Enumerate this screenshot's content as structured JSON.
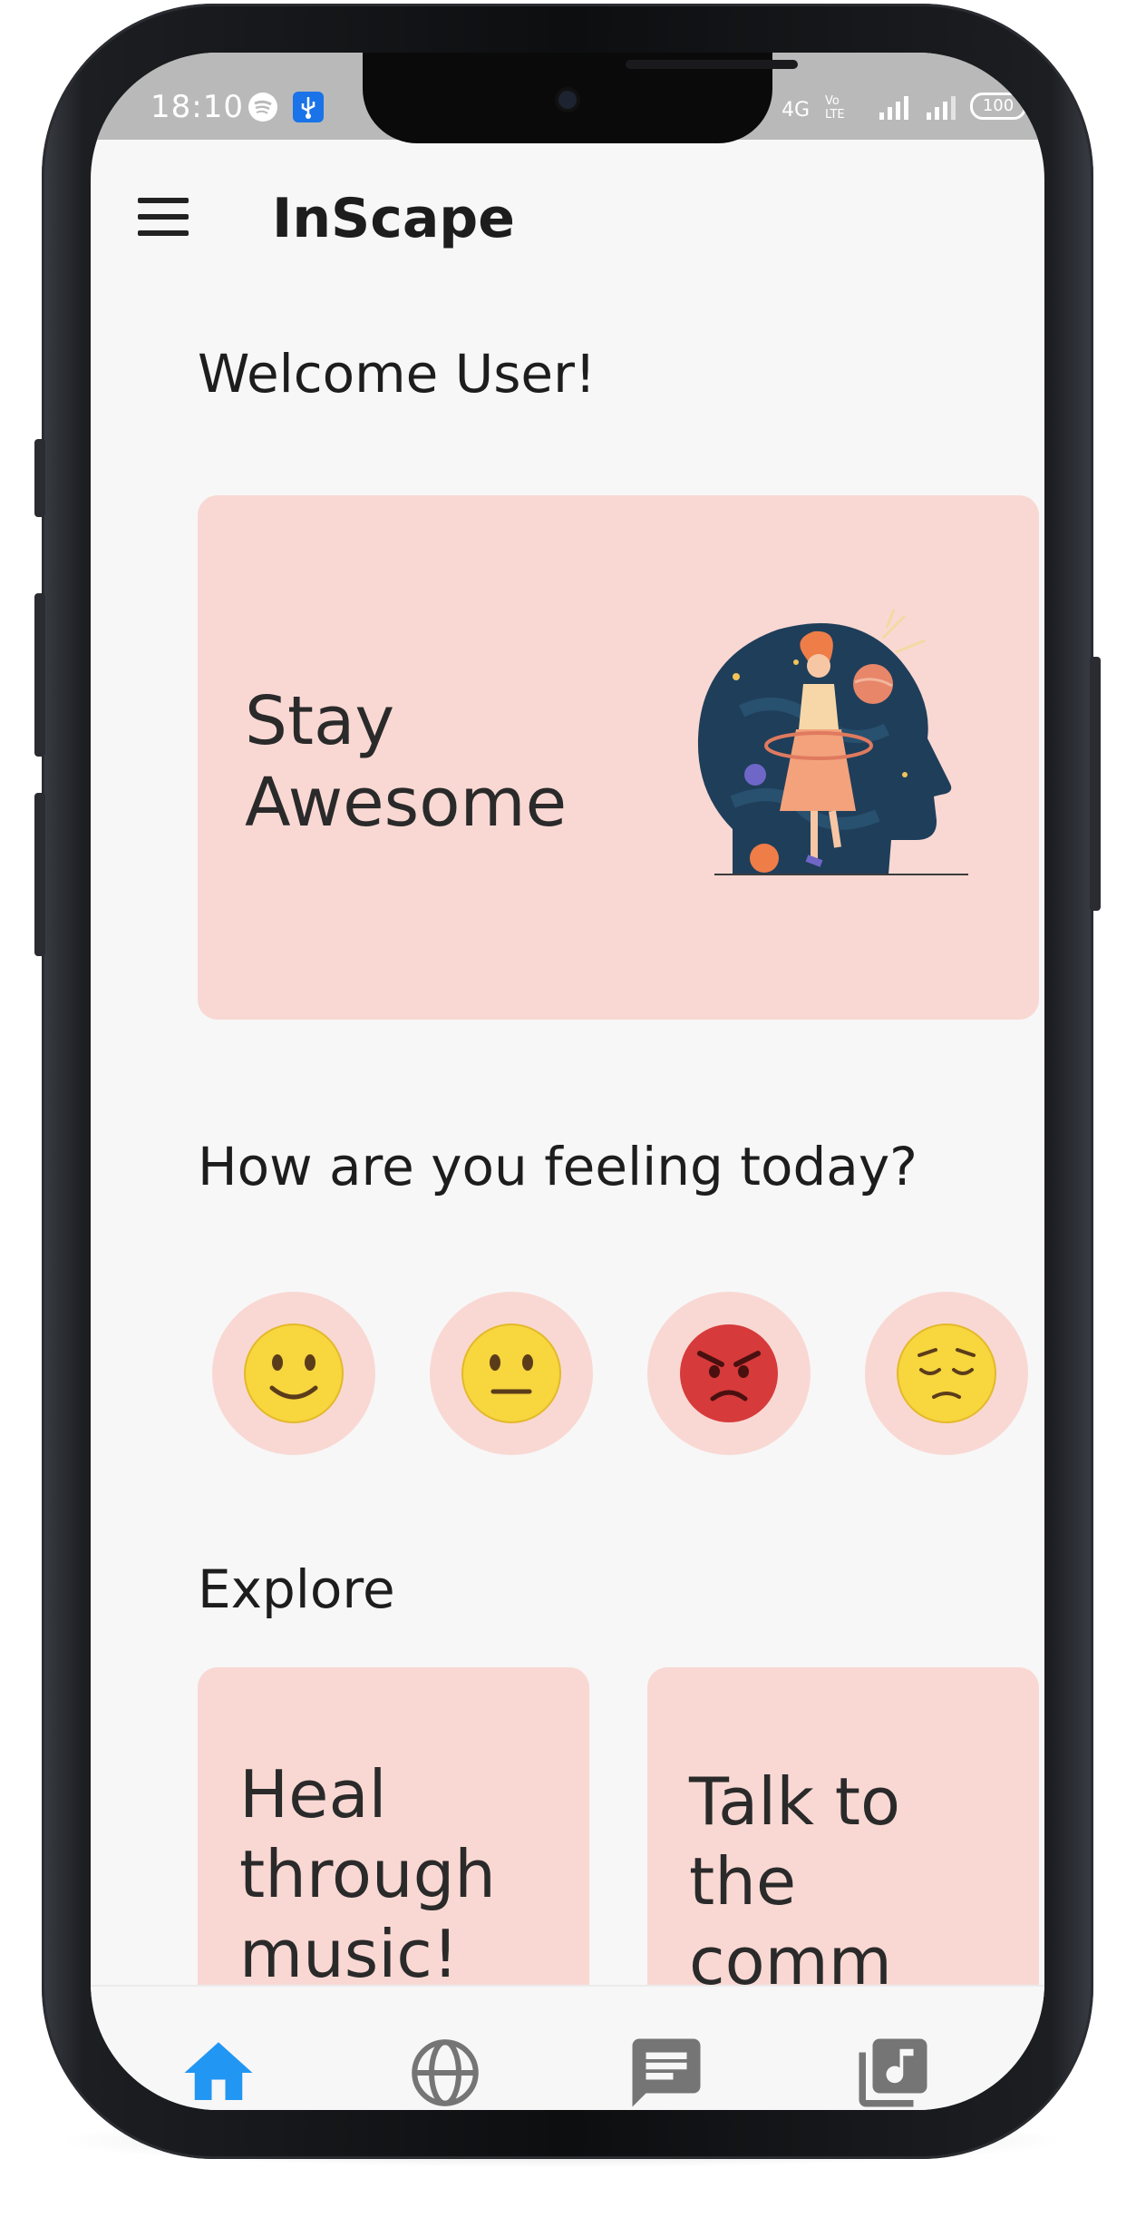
{
  "status_bar": {
    "time": "18:10",
    "battery": "100"
  },
  "app_bar": {
    "title": "InScape"
  },
  "welcome": "Welcome User!",
  "hero": {
    "text": "Stay Awesome"
  },
  "mood_section": {
    "title": "How are you feeling today?"
  },
  "explore": {
    "title": "Explore",
    "cards": [
      {
        "text": "Heal\nthrough\nmusic!"
      },
      {
        "text": "Talk to\nthe comm\nunity!"
      }
    ]
  },
  "colors": {
    "card_pink": "#f9d8d3",
    "nav_active": "#2196f3",
    "nav_inactive": "#757575"
  }
}
